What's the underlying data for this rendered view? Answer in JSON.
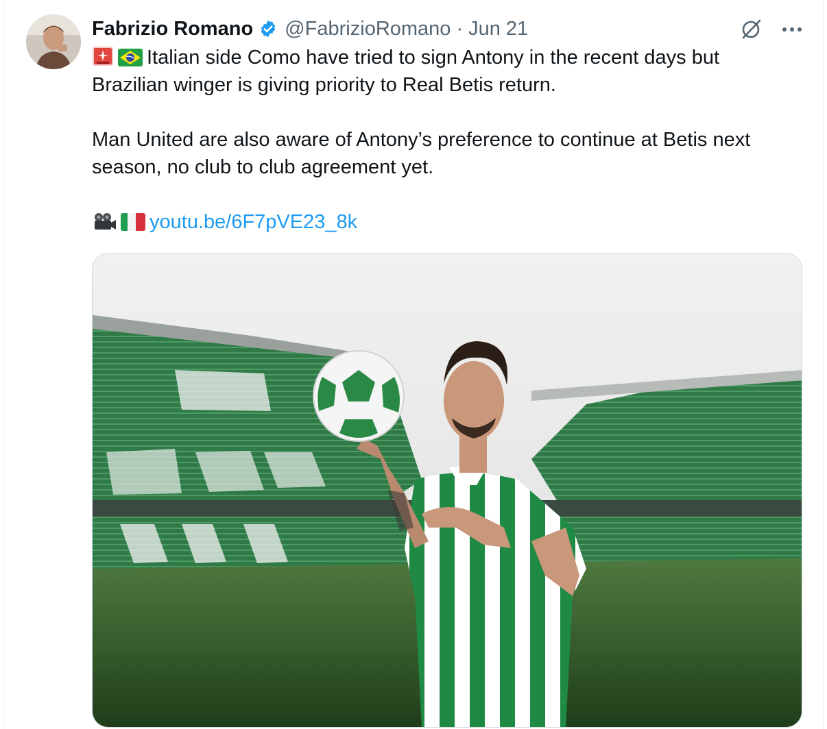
{
  "tweet": {
    "author_name": "Fabrizio Romano",
    "handle": "@FabrizioRomano",
    "separator": "·",
    "date": "Jun 21",
    "lines": [
      "Italian side Como have tried to sign Antony in the recent days but",
      "Brazilian winger is giving priority to Real Betis return.",
      "Man United are also aware of Antony’s preference to continue at Betis next",
      "season, no club to club agreement yet."
    ],
    "link_text": "youtu.be/6F7pVE23_8k",
    "icons": {
      "avatar": "avatar-photo",
      "verified": "verified-badge-icon",
      "grok": "grok-icon",
      "more": "more-icon",
      "siren": "siren-emoji",
      "brazil": "brazil-flag-emoji",
      "camera": "movie-camera-emoji",
      "italy": "italy-flag-emoji"
    },
    "colors": {
      "link": "#1d9bf0",
      "verified": "#1d9bf0",
      "muted": "#536471",
      "betis_green": "#2e8b4e"
    }
  }
}
